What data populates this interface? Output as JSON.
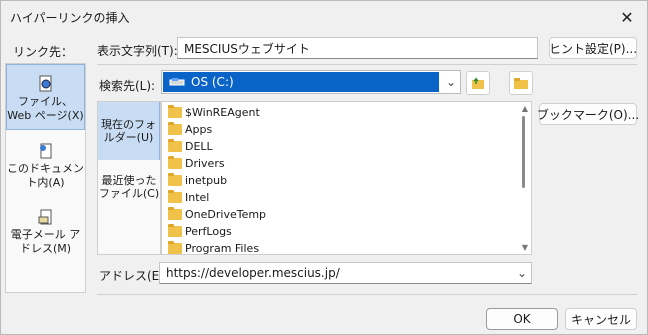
{
  "window": {
    "title": "ハイパーリンクの挿入",
    "close_glyph": "✕"
  },
  "link_to_label": "リンク先：",
  "left_nav": [
    {
      "label": "ファイル、Web ページ(X)",
      "icon": "web-page-icon",
      "selected": true
    },
    {
      "label": "このドキュメント内(A)",
      "icon": "document-icon",
      "selected": false
    },
    {
      "label": "電子メール アドレス(M)",
      "icon": "email-icon",
      "selected": false
    }
  ],
  "display_text": {
    "label": "表示文字列(T):",
    "value": "MESCIUSウェブサイト"
  },
  "hint_button": "ヒント設定(P)...",
  "search_in": {
    "label": "検索先(L):",
    "value": "OS (C:)",
    "drive_icon": "drive-icon"
  },
  "toolbar_icons": {
    "up": "up-folder-icon",
    "browse": "browse-folder-icon"
  },
  "bookmark_button": "ブックマーク(O)...",
  "side_items": [
    {
      "label": "現在のフォルダー(U)",
      "selected": true
    },
    {
      "label": "最近使ったファイル(C)",
      "selected": false
    }
  ],
  "files": [
    "$WinREAgent",
    "Apps",
    "DELL",
    "Drivers",
    "inetpub",
    "Intel",
    "OneDriveTemp",
    "PerfLogs",
    "Program Files"
  ],
  "address": {
    "label": "アドレス(E):",
    "value": "https://developer.mescius.jp/"
  },
  "ok_button": "OK",
  "cancel_button": "キャンセル",
  "colors": {
    "selection": "#0a64c8",
    "nav_selected": "#c8ddf3",
    "folder": "#f0c24a"
  }
}
